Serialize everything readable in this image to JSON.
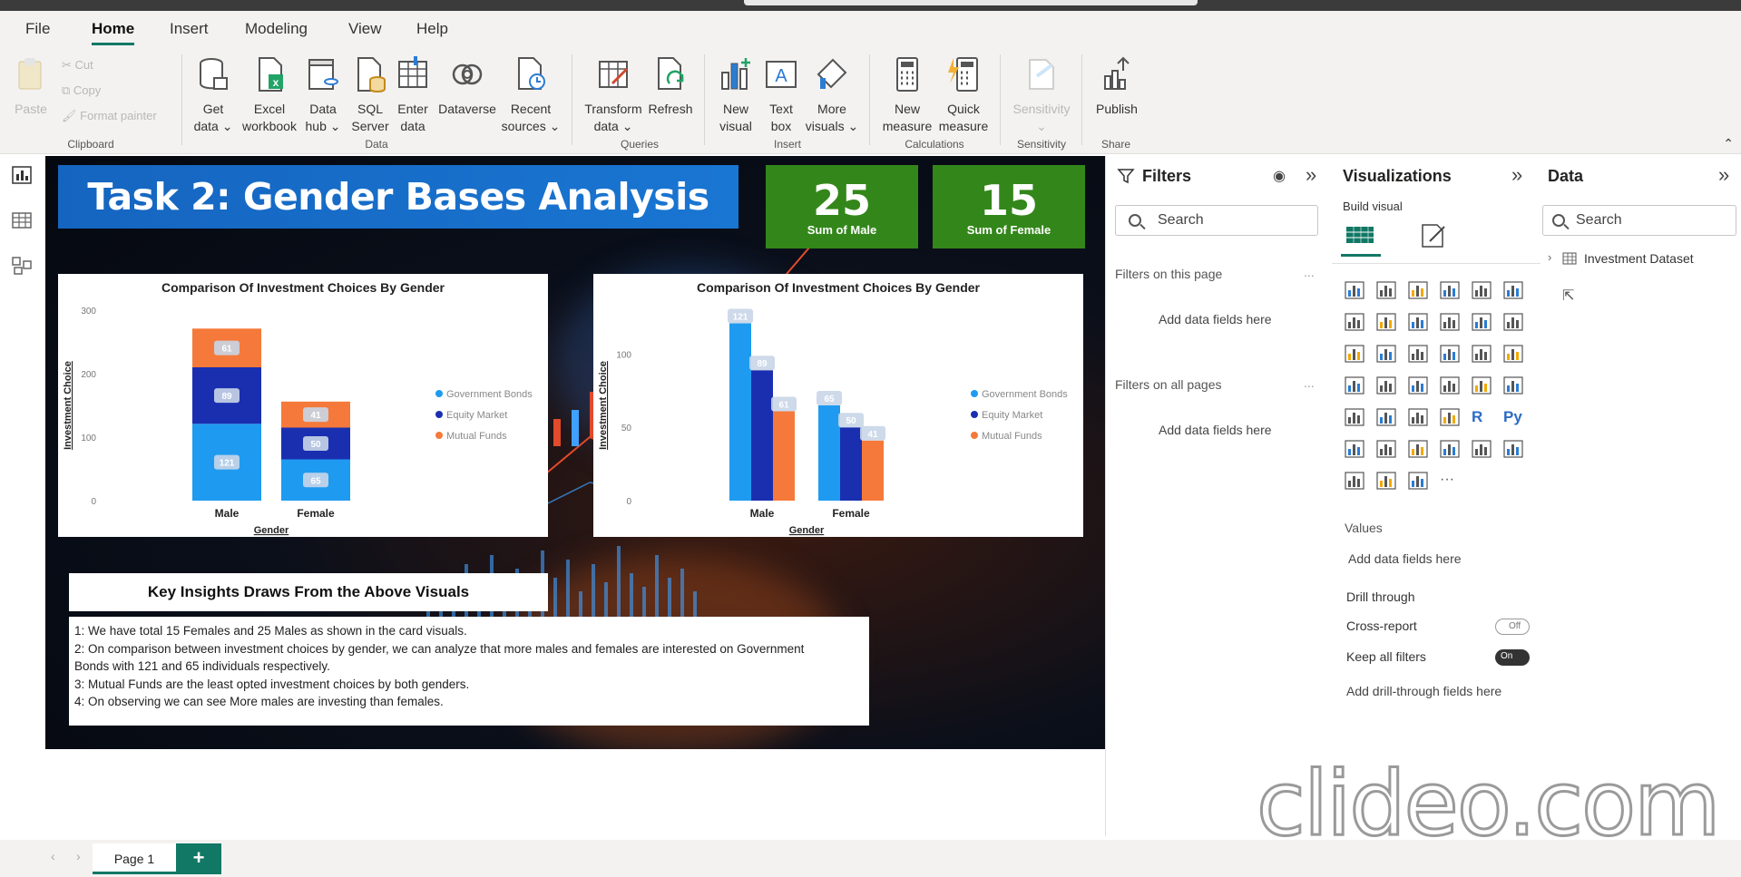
{
  "menu": {
    "items": [
      "File",
      "Home",
      "Insert",
      "Modeling",
      "View",
      "Help"
    ],
    "active": "Home"
  },
  "ribbon": {
    "clipboard": {
      "paste": "Paste",
      "cut": "Cut",
      "copy": "Copy",
      "format_painter": "Format painter",
      "group": "Clipboard"
    },
    "data": {
      "get_data": [
        "Get",
        "data ⌄"
      ],
      "excel": [
        "Excel",
        "workbook"
      ],
      "data_hub": [
        "Data",
        "hub ⌄"
      ],
      "sql": [
        "SQL",
        "Server"
      ],
      "enter": [
        "Enter",
        "data"
      ],
      "dataverse": [
        "Dataverse",
        ""
      ],
      "recent": [
        "Recent",
        "sources ⌄"
      ],
      "group": "Data"
    },
    "queries": {
      "transform": [
        "Transform",
        "data ⌄"
      ],
      "refresh": [
        "Refresh",
        ""
      ],
      "group": "Queries"
    },
    "insert": {
      "new_visual": [
        "New",
        "visual"
      ],
      "text_box": [
        "Text",
        "box"
      ],
      "more_visuals": [
        "More",
        "visuals ⌄"
      ],
      "group": "Insert"
    },
    "calculations": {
      "new_measure": [
        "New",
        "measure"
      ],
      "quick_measure": [
        "Quick",
        "measure"
      ],
      "group": "Calculations"
    },
    "sensitivity": {
      "label": [
        "Sensitivity",
        "⌄"
      ],
      "group": "Sensitivity"
    },
    "share": {
      "publish": [
        "Publish",
        ""
      ],
      "group": "Share"
    }
  },
  "report": {
    "banner_title": "Task 2: Gender Bases Analysis",
    "cards": [
      {
        "value": "25",
        "label": "Sum of Male"
      },
      {
        "value": "15",
        "label": "Sum of Female"
      }
    ],
    "insights_title": "Key Insights Draws From the Above Visuals",
    "insights": [
      "1: We have total 15 Females and 25 Males as shown in the card visuals.",
      "2: On comparison between investment choices by gender, we can analyze that more males and females are  interested on Government",
      "Bonds with 121 and 65 individuals respectively.",
      "3: Mutual Funds are the least opted investment choices by both genders.",
      "4: On observing we can see More males are investing than females."
    ]
  },
  "chart_data": [
    {
      "type": "bar",
      "stacked": true,
      "title": "Comparison Of Investment Choices By Gender",
      "xlabel": "Gender",
      "ylabel": "Investment Choice",
      "categories": [
        "Male",
        "Female"
      ],
      "series": [
        {
          "name": "Government Bonds",
          "values": [
            121,
            65
          ],
          "color": "#1e9bf0"
        },
        {
          "name": "Equity Market",
          "values": [
            89,
            50
          ],
          "color": "#1a2fb0"
        },
        {
          "name": "Mutual Funds",
          "values": [
            61,
            41
          ],
          "color": "#f5793a"
        }
      ],
      "ylim": [
        0,
        300
      ],
      "yticks": [
        0,
        100,
        200,
        300
      ],
      "legend": "right",
      "grid": false
    },
    {
      "type": "bar",
      "stacked": false,
      "title": "Comparison Of Investment Choices By Gender",
      "xlabel": "Gender",
      "ylabel": "Investment Choice",
      "categories": [
        "Male",
        "Female"
      ],
      "series": [
        {
          "name": "Government Bonds",
          "values": [
            121,
            65
          ],
          "color": "#1e9bf0"
        },
        {
          "name": "Equity Market",
          "values": [
            89,
            50
          ],
          "color": "#1a2fb0"
        },
        {
          "name": "Mutual Funds",
          "values": [
            61,
            41
          ],
          "color": "#f5793a"
        }
      ],
      "ylim": [
        0,
        130
      ],
      "yticks": [
        0,
        50,
        100
      ],
      "legend": "right",
      "grid": false
    }
  ],
  "filters": {
    "title": "Filters",
    "search_placeholder": "Search",
    "on_page": "Filters on this page",
    "on_all": "Filters on all pages",
    "add_fields": "Add data fields here",
    "more": "..."
  },
  "visualizations": {
    "title": "Visualizations",
    "build_visual": "Build visual",
    "values_label": "Values",
    "values_placeholder": "Add data fields here",
    "drill_through": "Drill through",
    "cross_report": "Cross-report",
    "cross_report_state": "Off",
    "keep_filters": "Keep all filters",
    "keep_filters_state": "On",
    "drill_placeholder": "Add drill-through fields here",
    "r_icon": "R",
    "py_icon": "Py",
    "more_icon": "···"
  },
  "data_pane": {
    "title": "Data",
    "search_placeholder": "Search",
    "table": "Investment Dataset"
  },
  "pages": {
    "tab": "Page 1",
    "add": "+"
  },
  "watermark": "clideo.com",
  "colors": {
    "accent": "#117865",
    "card_green": "#33871a",
    "banner_blue": "#1976d2"
  }
}
